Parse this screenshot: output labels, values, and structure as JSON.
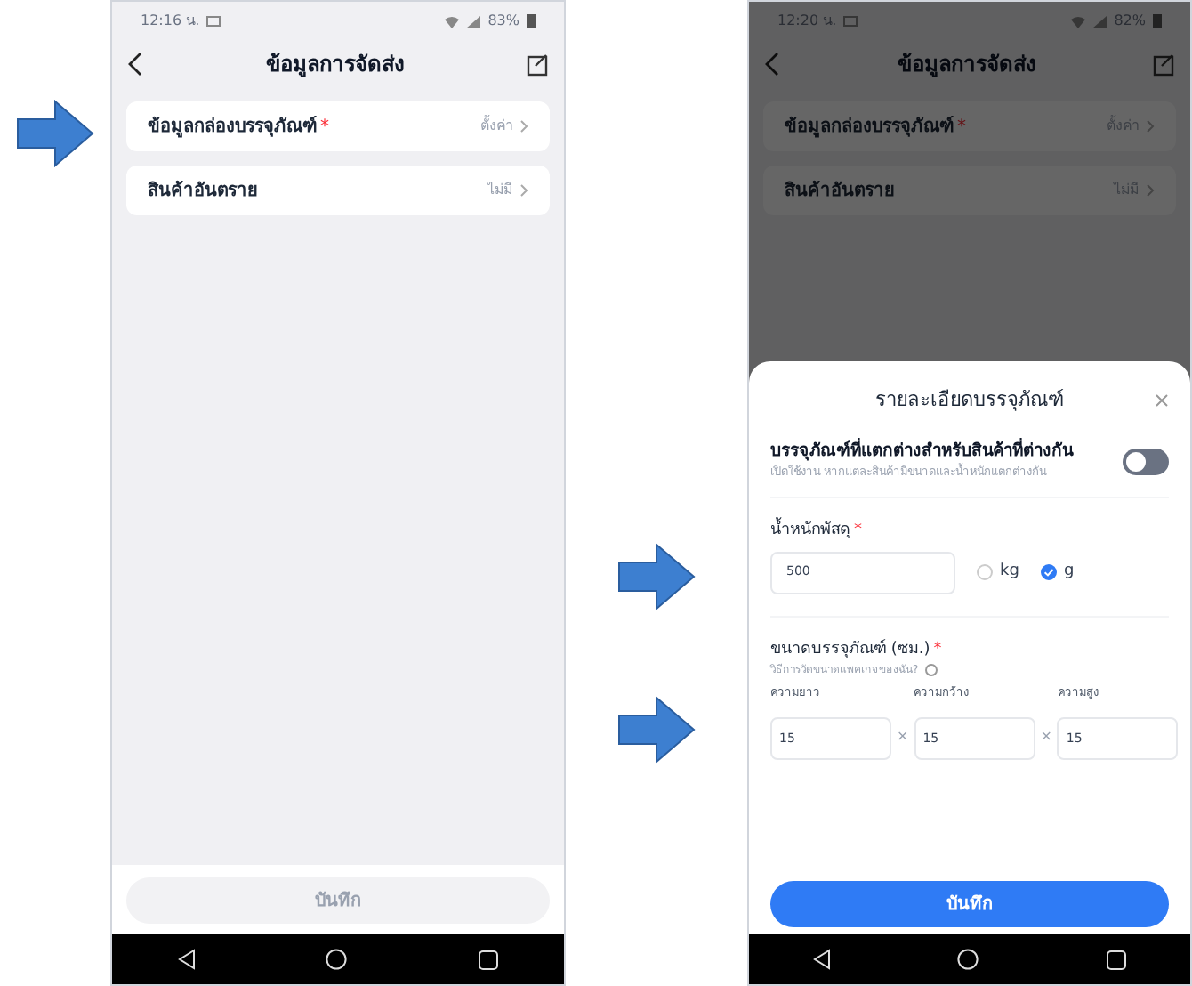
{
  "screens": [
    {
      "status_bar": {
        "time": "12:16 น.",
        "battery": "83%"
      },
      "header": {
        "title": "ข้อมูลการจัดส่ง"
      },
      "rows": [
        {
          "label": "ข้อมูลกล่องบรรจุภัณฑ์",
          "required_mark": "*",
          "value": "ตั้งค่า"
        },
        {
          "label": "สินค้าอันตราย",
          "value": "ไม่มี"
        }
      ],
      "save_button": {
        "label": "บันทึก",
        "disabled": true
      }
    },
    {
      "status_bar": {
        "time": "12:20 น.",
        "battery": "82%"
      },
      "header": {
        "title": "ข้อมูลการจัดส่ง"
      },
      "rows": [
        {
          "label": "ข้อมูลกล่องบรรจุภัณฑ์",
          "required_mark": "*",
          "value": "ตั้งค่า"
        },
        {
          "label": "สินค้าอันตราย",
          "value": "ไม่มี"
        }
      ],
      "sheet": {
        "title": "รายละเอียดบรรจุภัณฑ์",
        "toggle": {
          "label": "บรรจุภัณฑ์ที่แตกต่างสำหรับสินค้าที่ต่างกัน",
          "hint": "เปิดใช้งาน หากแต่ละสินค้ามีขนาดและน้ำหนักแตกต่างกัน",
          "on": false
        },
        "weight": {
          "label": "น้ำหนักพัสดุ",
          "required_mark": "*",
          "value": "500",
          "units": [
            {
              "label": "kg",
              "selected": false
            },
            {
              "label": "g",
              "selected": true
            }
          ]
        },
        "size": {
          "label": "ขนาดบรรจุภัณฑ์ (ซม.)",
          "required_mark": "*",
          "hint": "วิธีการวัดขนาดแพคเกจของฉัน?",
          "separator": "×",
          "fields": [
            {
              "label": "ความยาว",
              "value": "15"
            },
            {
              "label": "ความกว้าง",
              "value": "15"
            },
            {
              "label": "ความสูง",
              "value": "15"
            }
          ]
        },
        "save_button": {
          "label": "บันทึก",
          "disabled": false
        }
      }
    }
  ]
}
